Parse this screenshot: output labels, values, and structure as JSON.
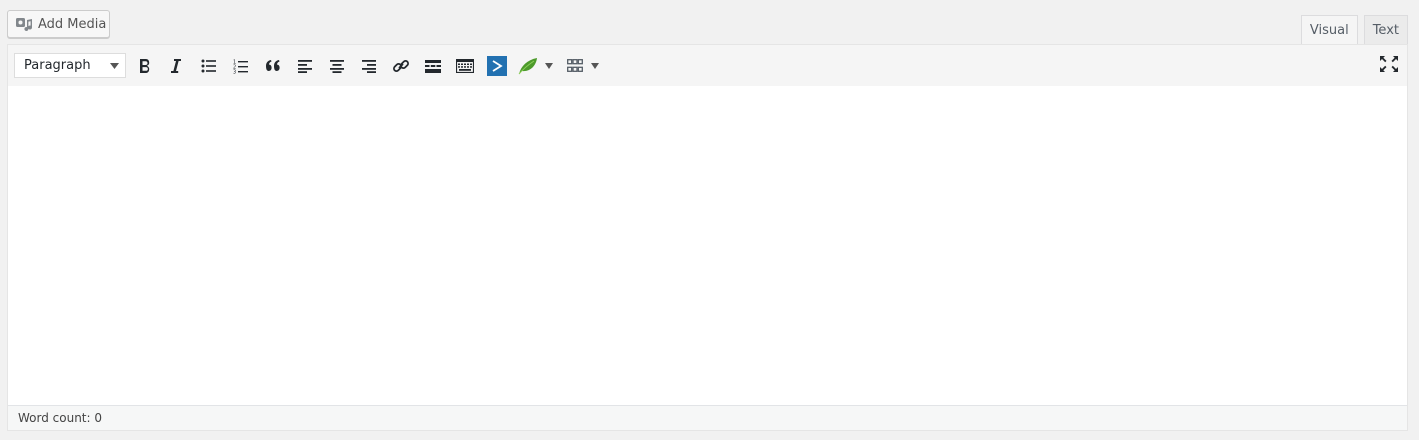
{
  "add_media": {
    "label": "Add Media",
    "icon": "media-icon"
  },
  "tabs": [
    {
      "label": "Visual",
      "active": true
    },
    {
      "label": "Text",
      "active": false
    }
  ],
  "toolbar": {
    "format_select": {
      "value": "Paragraph"
    },
    "buttons": [
      {
        "name": "bold-button",
        "icon": "bold-icon"
      },
      {
        "name": "italic-button",
        "icon": "italic-icon"
      },
      {
        "name": "bulleted-list-button",
        "icon": "bulleted-list-icon"
      },
      {
        "name": "numbered-list-button",
        "icon": "numbered-list-icon"
      },
      {
        "name": "blockquote-button",
        "icon": "quote-icon"
      },
      {
        "name": "align-left-button",
        "icon": "align-left-icon"
      },
      {
        "name": "align-center-button",
        "icon": "align-center-icon"
      },
      {
        "name": "align-right-button",
        "icon": "align-right-icon"
      },
      {
        "name": "insert-link-button",
        "icon": "link-icon"
      },
      {
        "name": "read-more-button",
        "icon": "read-more-icon"
      },
      {
        "name": "toolbar-toggle-button",
        "icon": "keyboard-icon"
      },
      {
        "name": "shortcode-button",
        "icon": "chevron-right-icon"
      },
      {
        "name": "leaf-plugin-button",
        "icon": "leaf-icon"
      },
      {
        "name": "grid-blocks-button",
        "icon": "grid-icon"
      },
      {
        "name": "fullscreen-button",
        "icon": "fullscreen-icon"
      }
    ],
    "accent_blue": "#2271b1",
    "leaf_green": "#4c9a2a"
  },
  "status": {
    "word_count_label": "Word count:",
    "word_count_value": "0"
  }
}
